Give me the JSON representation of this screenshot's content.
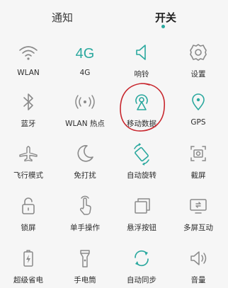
{
  "tabs": [
    {
      "label": "通知",
      "active": false
    },
    {
      "label": "开关",
      "active": true
    }
  ],
  "accent_color": "#2aa89e",
  "icon_gray": "#8a8a8a",
  "annotation_color": "#c8262d",
  "tiles": [
    {
      "label": "WLAN",
      "icon": "wifi-icon",
      "active": false
    },
    {
      "label": "4G",
      "icon": "4g-icon",
      "active": true
    },
    {
      "label": "响铃",
      "icon": "speaker-icon",
      "active": true
    },
    {
      "label": "设置",
      "icon": "gear-icon",
      "active": false
    },
    {
      "label": "蓝牙",
      "icon": "bluetooth-icon",
      "active": false
    },
    {
      "label": "WLAN 热点",
      "icon": "hotspot-icon",
      "active": false
    },
    {
      "label": "移动数据",
      "icon": "mobile-data-icon",
      "active": true
    },
    {
      "label": "GPS",
      "icon": "location-pin-icon",
      "active": true
    },
    {
      "label": "飞行模式",
      "icon": "airplane-icon",
      "active": false
    },
    {
      "label": "免打扰",
      "icon": "moon-icon",
      "active": false
    },
    {
      "label": "自动旋转",
      "icon": "rotate-icon",
      "active": true
    },
    {
      "label": "截屏",
      "icon": "screenshot-icon",
      "active": false
    },
    {
      "label": "锁屏",
      "icon": "lock-icon",
      "active": false
    },
    {
      "label": "单手操作",
      "icon": "one-hand-icon",
      "active": false
    },
    {
      "label": "悬浮按钮",
      "icon": "floating-button-icon",
      "active": false
    },
    {
      "label": "多屏互动",
      "icon": "multi-screen-icon",
      "active": false
    },
    {
      "label": "超级省电",
      "icon": "battery-icon",
      "active": false
    },
    {
      "label": "手电筒",
      "icon": "flashlight-icon",
      "active": false
    },
    {
      "label": "自动同步",
      "icon": "sync-icon",
      "active": true
    },
    {
      "label": "音量",
      "icon": "volume-icon",
      "active": false
    }
  ]
}
